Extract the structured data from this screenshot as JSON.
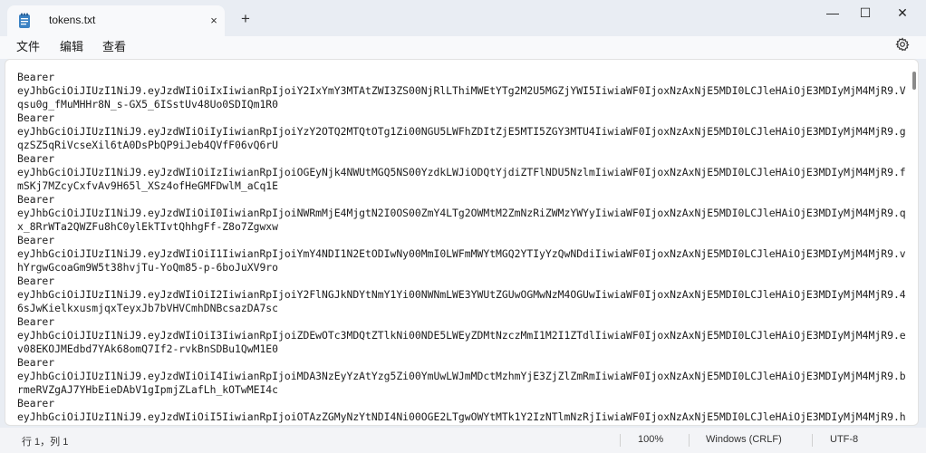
{
  "window": {
    "tab_title": "tokens.txt",
    "tab_close_icon": "×",
    "new_tab_icon": "+",
    "minimize_icon": "—",
    "maximize_icon": "☐",
    "close_icon": "✕"
  },
  "menu": {
    "file": "文件",
    "edit": "编辑",
    "view": "查看"
  },
  "editor": {
    "lines": [
      "Bearer",
      "eyJhbGciOiJIUzI1NiJ9.eyJzdWIiOiIxIiwianRpIjoiY2IxYmY3MTAtZWI3ZS00NjRlLThiMWEtYTg2M2U5MGZjYWI5IiwiaWF0IjoxNzAxNjE5MDI0LCJleHAiOjE3MDIyMjM4MjR9.V",
      "qsu0g_fMuMHHr8N_s-GX5_6ISstUv48Uo0SDIQm1R0",
      "Bearer",
      "eyJhbGciOiJIUzI1NiJ9.eyJzdWIiOiIyIiwianRpIjoiYzY2OTQ2MTQtOTg1Zi00NGU5LWFhZDItZjE5MTI5ZGY3MTU4IiwiaWF0IjoxNzAxNjE5MDI0LCJleHAiOjE3MDIyMjM4MjR9.g",
      "qzSZ5qRiVcseXil6tA0DsPbQP9iJeb4QVfF06vQ6rU",
      "Bearer",
      "eyJhbGciOiJIUzI1NiJ9.eyJzdWIiOiIzIiwianRpIjoiOGEyNjk4NWUtMGQ5NS00YzdkLWJiODQtYjdiZTFlNDU5NzlmIiwiaWF0IjoxNzAxNjE5MDI0LCJleHAiOjE3MDIyMjM4MjR9.f",
      "mSKj7MZcyCxfvAv9H65l_XSz4ofHeGMFDwlM_aCq1E",
      "Bearer",
      "eyJhbGciOiJIUzI1NiJ9.eyJzdWIiOiI0IiwianRpIjoiNWRmMjE4MjgtN2I0OS00ZmY4LTg2OWMtM2ZmNzRiZWMzYWYyIiwiaWF0IjoxNzAxNjE5MDI0LCJleHAiOjE3MDIyMjM4MjR9.q",
      "x_8RrWTa2QWZFu8hC0ylEkTIvtQhhgFf-Z8o7Zgwxw",
      "Bearer",
      "eyJhbGciOiJIUzI1NiJ9.eyJzdWIiOiI1IiwianRpIjoiYmY4NDI1N2EtODIwNy00MmI0LWFmMWYtMGQ2YTIyYzQwNDdiIiwiaWF0IjoxNzAxNjE5MDI0LCJleHAiOjE3MDIyMjM4MjR9.v",
      "hYrgwGcoaGm9W5t38hvjTu-YoQm85-p-6boJuXV9ro",
      "Bearer",
      "eyJhbGciOiJIUzI1NiJ9.eyJzdWIiOiI2IiwianRpIjoiY2FlNGJkNDYtNmY1Yi00NWNmLWE3YWUtZGUwOGMwNzM4OGUwIiwiaWF0IjoxNzAxNjE5MDI0LCJleHAiOjE3MDIyMjM4MjR9.4",
      "6sJwKielkxusmjqxTeyxJb7bVHVCmhDNBcsazDA7sc",
      "Bearer",
      "eyJhbGciOiJIUzI1NiJ9.eyJzdWIiOiI3IiwianRpIjoiZDEwOTc3MDQtZTlkNi00NDE5LWEyZDMtNzczMmI1M2I1ZTdlIiwiaWF0IjoxNzAxNjE5MDI0LCJleHAiOjE3MDIyMjM4MjR9.e",
      "v08EKOJMEdbd7YAk68omQ7If2-rvkBnSDBu1QwM1E0",
      "Bearer",
      "eyJhbGciOiJIUzI1NiJ9.eyJzdWIiOiI4IiwianRpIjoiMDA3NzEyYzAtYzg5Zi00YmUwLWJmMDctMzhmYjE3ZjZlZmRmIiwiaWF0IjoxNzAxNjE5MDI0LCJleHAiOjE3MDIyMjM4MjR9.b",
      "rmeRVZgAJ7YHbEieDAbV1gIpmjZLafLh_kOTwMEI4c",
      "Bearer",
      "eyJhbGciOiJIUzI1NiJ9.eyJzdWIiOiI5IiwianRpIjoiOTAzZGMyNzYtNDI4Ni00OGE2LTgwOWYtMTk1Y2IzNTlmNzRjIiwiaWF0IjoxNzAxNjE5MDI0LCJleHAiOjE3MDIyMjM4MjR9.h"
    ]
  },
  "status": {
    "position": "行 1，列 1",
    "zoom": "100%",
    "line_ending": "Windows (CRLF)",
    "encoding": "UTF-8"
  },
  "colors": {
    "tab_icon": "#3b82c4",
    "chrome": "#e9edf3"
  }
}
